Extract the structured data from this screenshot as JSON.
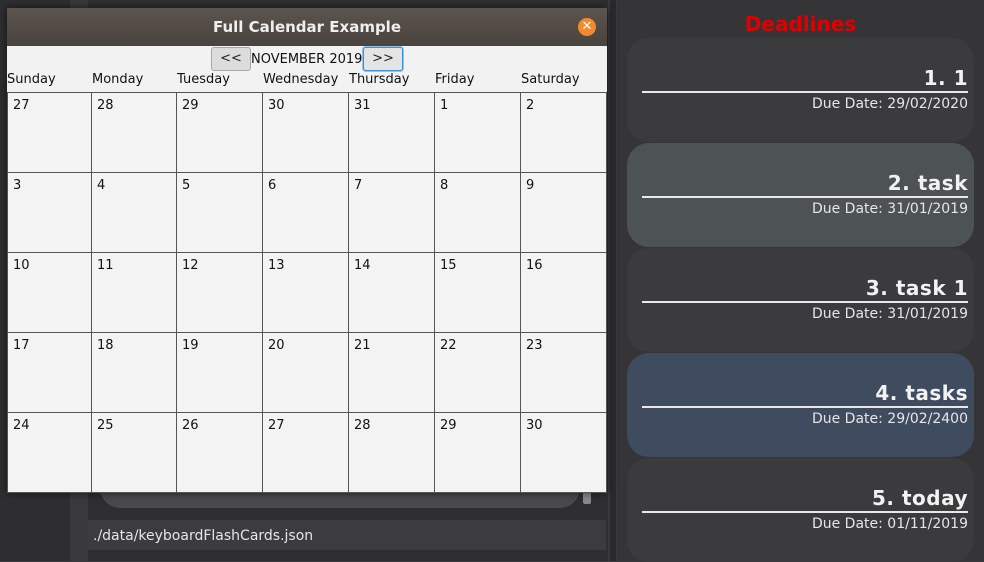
{
  "calendar": {
    "title": "Full Calendar Example",
    "close_icon": "close-icon",
    "prev_label": "<<",
    "next_label": ">>",
    "month_label": "NOVEMBER 2019",
    "days_of_week": [
      "Sunday",
      "Monday",
      "Tuesday",
      "Wednesday",
      "Thursday",
      "Friday",
      "Saturday"
    ],
    "weeks": [
      [
        "27",
        "28",
        "29",
        "30",
        "31",
        "1",
        "2"
      ],
      [
        "3",
        "4",
        "5",
        "6",
        "7",
        "8",
        "9"
      ],
      [
        "10",
        "11",
        "12",
        "13",
        "14",
        "15",
        "16"
      ],
      [
        "17",
        "18",
        "19",
        "20",
        "21",
        "22",
        "23"
      ],
      [
        "24",
        "25",
        "26",
        "27",
        "28",
        "29",
        "30"
      ]
    ]
  },
  "status_bar": {
    "path": "./data/keyboardFlashCards.json"
  },
  "deadlines": {
    "title": "Deadlines",
    "title_color": "#e00000",
    "items": [
      {
        "name": "1.  1",
        "due": "Due Date: 29/02/2020",
        "color": "#3b3b3d"
      },
      {
        "name": "2.  task",
        "due": "Due Date: 31/01/2019",
        "color": "#4d5253"
      },
      {
        "name": "3.  task 1",
        "due": "Due Date: 31/01/2019",
        "color": "#3b3b3d"
      },
      {
        "name": "4.  tasks",
        "due": "Due Date: 29/02/2400",
        "color": "#3f4b5e"
      },
      {
        "name": "5.  today",
        "due": "Due Date: 01/11/2019",
        "color": "#3b3b3d"
      }
    ]
  }
}
